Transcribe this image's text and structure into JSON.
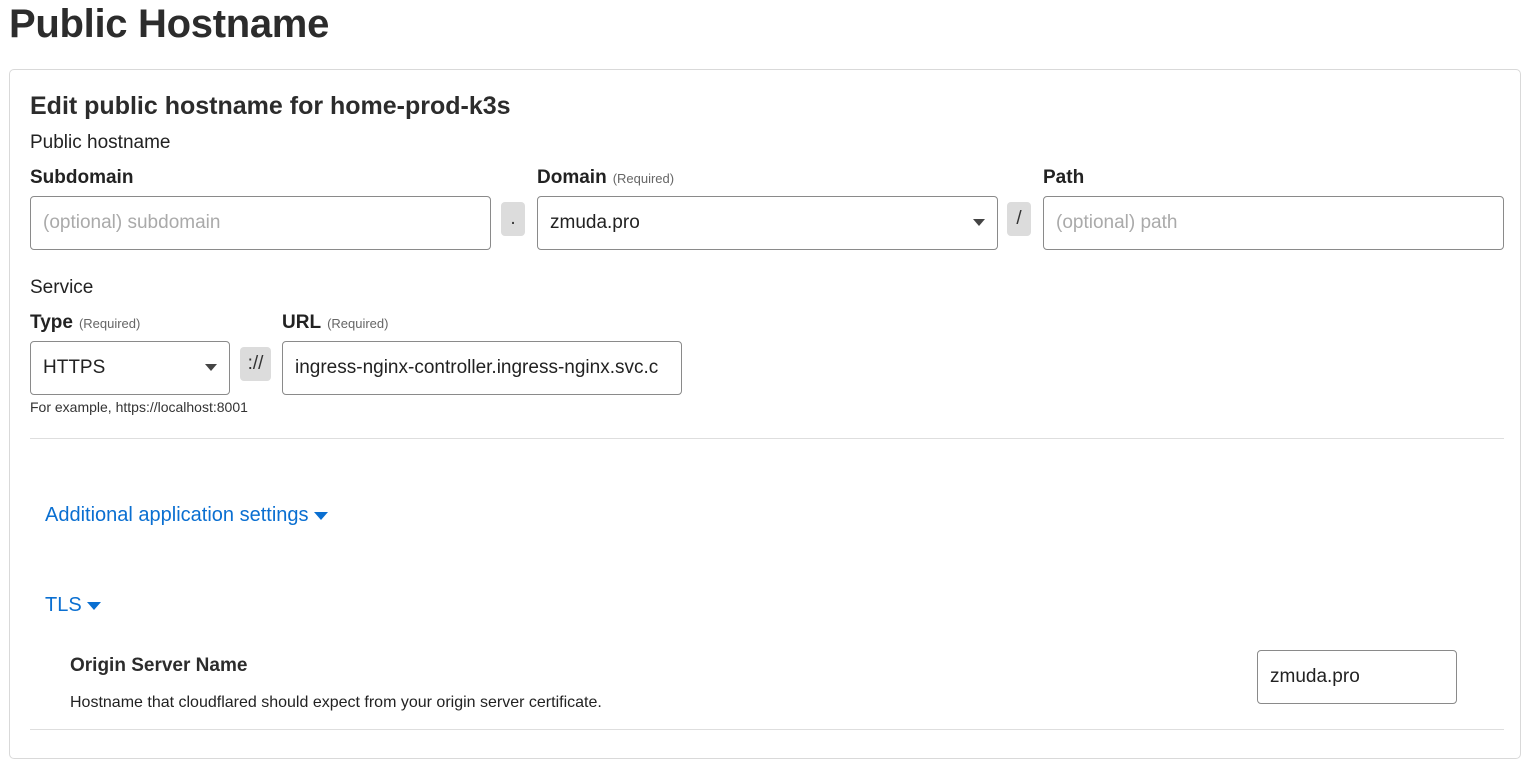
{
  "page": {
    "title": "Public Hostname"
  },
  "card": {
    "title": "Edit public hostname for home-prod-k3s"
  },
  "hostname": {
    "section_label": "Public hostname",
    "subdomain": {
      "label": "Subdomain",
      "placeholder": "(optional) subdomain"
    },
    "dot_separator": ".",
    "domain": {
      "label": "Domain",
      "required": "(Required)",
      "value": "zmuda.pro"
    },
    "slash_separator": "/",
    "path": {
      "label": "Path",
      "placeholder": "(optional) path"
    }
  },
  "service": {
    "section_label": "Service",
    "type": {
      "label": "Type",
      "required": "(Required)",
      "value": "HTTPS"
    },
    "scheme_separator": "://",
    "url": {
      "label": "URL",
      "required": "(Required)",
      "value": "ingress-nginx-controller.ingress-nginx.svc.c"
    },
    "hint": "For example, https://localhost:8001"
  },
  "additional_settings": {
    "label": "Additional application settings"
  },
  "tls": {
    "label": "TLS",
    "origin_server_name": {
      "title": "Origin Server Name",
      "description": "Hostname that cloudflared should expect from your origin server certificate.",
      "value": "zmuda.pro"
    }
  },
  "colors": {
    "link": "#0a6fd1",
    "border": "#8a8a8a",
    "separator_bg": "#dcdcdc"
  },
  "icons": {
    "dropdown": "caret-down-icon",
    "expand": "triangle-down-icon"
  }
}
